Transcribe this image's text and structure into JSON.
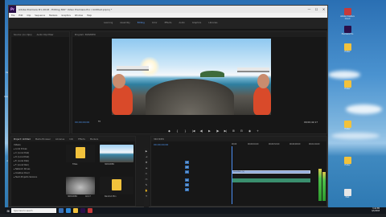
{
  "app": {
    "logo": "Pr",
    "window_title": "Adobe Premiere Pro 2018 - Editing 360° Video Premiere Pro \\ Untitled.prproj *",
    "window_controls": [
      "—",
      "☐",
      "✕"
    ],
    "menu": [
      "File",
      "Edit",
      "Clip",
      "Sequence",
      "Markers",
      "Graphics",
      "Window",
      "Help"
    ]
  },
  "workspaces": [
    {
      "label": "Learning",
      "active": false
    },
    {
      "label": "Assembly",
      "active": false
    },
    {
      "label": "Editing",
      "active": true
    },
    {
      "label": "Color",
      "active": false
    },
    {
      "label": "Effects",
      "active": false
    },
    {
      "label": "Audio",
      "active": false
    },
    {
      "label": "Graphics",
      "active": false
    },
    {
      "label": "Libraries",
      "active": false
    }
  ],
  "source_panel": {
    "tabs": [
      "Source: (no clips)",
      "Audio Clip Mixer"
    ]
  },
  "program_panel": {
    "tab": "Program: 360VIDEO",
    "timecode_left": "00;00;00;00",
    "fit": "Fit",
    "timecode_right": "00;00;42;17",
    "controls": [
      "◆",
      "{",
      "}",
      "|◀",
      "◀|",
      "▶",
      "|▶",
      "▶|",
      "⊞",
      "⊟",
      "◉",
      "+"
    ]
  },
  "project_panel": {
    "tabs": [
      "Project: Untitled",
      "Media Browser",
      "Libraries",
      "Info",
      "Effects",
      "Markers"
    ],
    "active_tab": "Project: Untitled",
    "breadcrumb": "Untitled.prproj",
    "items": [
      {
        "name": "360VIDEO",
        "duration": "",
        "type": "sequence"
      },
      {
        "name": "360VIDEO",
        "duration": "42;17",
        "type": "clip"
      },
      {
        "name": "Titles",
        "duration": "",
        "type": "folder"
      },
      {
        "name": "Random Bin",
        "duration": "",
        "type": "folder"
      }
    ]
  },
  "media_tree": {
    "header": "Videos",
    "rows": [
      "▸ Local Drives",
      "  ▸ C: (Local Disk)",
      "  ▸ D: (Local Disk)",
      "  ▸ E: (Local Disk)",
      "  ▸ F: (Local Disk)",
      "▸ Network Drives",
      "▸ Creative Cloud",
      "  ▸ Team Projects Versions"
    ]
  },
  "tools": [
    "▶",
    "⇥",
    "✥",
    "⇹",
    "✂",
    "▭",
    "✎",
    "✋",
    "T"
  ],
  "timeline": {
    "tab": "360VIDEO",
    "timecode": "00;00;00;00",
    "ruler": [
      "00;00",
      "00;00;16;00",
      "00;00;32;00",
      "00;00;48;00",
      "00;01;04;00"
    ],
    "video_tracks": [
      "V3",
      "V2",
      "V1"
    ],
    "audio_tracks": [
      "A1",
      "A2",
      "A3"
    ],
    "clip_label": "360VIDEO [V]"
  },
  "taskbar": {
    "search_placeholder": "Type here to search",
    "time": "3:44 PM",
    "date": "4/1/2018"
  },
  "desktop": {
    "left_icons": [
      "Recycle Bin",
      "Google Chrome",
      "This PC",
      "Adobe CC"
    ],
    "right_icons": [
      "Adobe Creative Cloud",
      "Premiere Pro",
      "Folder",
      "Folder",
      "Folder",
      "Folder",
      "Mail"
    ]
  },
  "colors": {
    "accent": "#4f96f0",
    "clip_video": "#8ca8d8",
    "clip_audio": "#3a8f6e",
    "folder": "#f2c23c"
  }
}
